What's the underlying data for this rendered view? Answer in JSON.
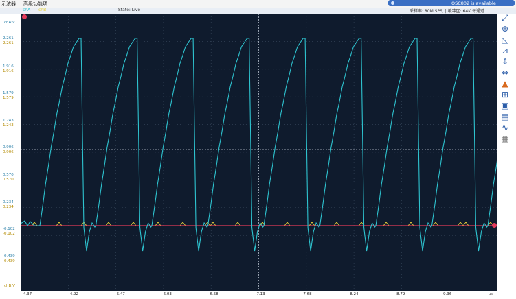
{
  "menu": {
    "items": [
      "示波器",
      "高级功能项"
    ]
  },
  "device": {
    "banner": "OSC802  is available"
  },
  "scope": {
    "state": "State: Live",
    "sample_info": "采样率: 80M SPS, | 缓冲区: 64K 每通道",
    "ch_labels": [
      "chA",
      "chB"
    ],
    "colors": {
      "chA": "#2ec3cf",
      "chB": "#e8d23a",
      "ground": "#e23a5a",
      "grid": "#3b4b60",
      "background": "#0f1b2d"
    }
  },
  "y_axis": {
    "top_label": "chA:V",
    "bottom_label": "chB:V",
    "ticks": [
      {
        "chA": "2.261",
        "chB": "2.261"
      },
      {
        "chA": "1.916",
        "chB": "1.916"
      },
      {
        "chA": "1.579",
        "chB": "1.579"
      },
      {
        "chA": "1.243",
        "chB": "1.243"
      },
      {
        "chA": "0.906",
        "chB": "0.906"
      },
      {
        "chA": "0.570",
        "chB": "0.570"
      },
      {
        "chA": "0.234",
        "chB": "0.234"
      },
      {
        "chA": "-0.102",
        "chB": "-0.102"
      },
      {
        "chA": "-0.439",
        "chB": "-0.439"
      }
    ]
  },
  "x_axis": {
    "unit": "us",
    "ticks": [
      "4.37",
      "4.92",
      "5.47",
      "6.03",
      "6.58",
      "7.13",
      "7.68",
      "8.24",
      "8.79",
      "9.36"
    ]
  },
  "tools": [
    "expand-icon",
    "zoom-icon",
    "ruler-icon",
    "measure-icon",
    "horizontal-cursor-icon",
    "vertical-cursor-icon",
    "fft-icon",
    "grid-icon",
    "save-icon",
    "image-icon",
    "waveform-icon",
    "table-icon"
  ]
}
